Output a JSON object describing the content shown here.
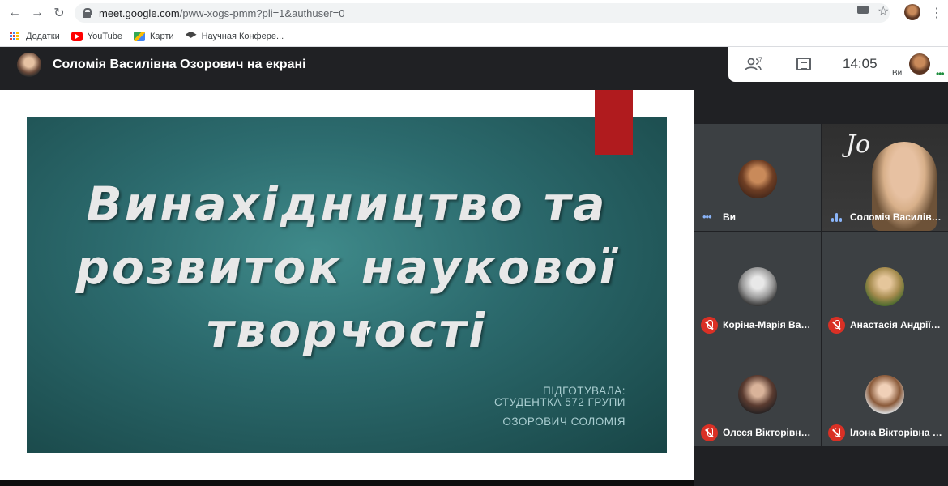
{
  "browser": {
    "url_host": "meet.google.com",
    "url_path": "/pww-xogs-pmm?pli=1&authuser=0",
    "bookmarks": [
      {
        "label": "Додатки",
        "icon": "apps-icon"
      },
      {
        "label": "YouTube",
        "icon": "youtube-icon"
      },
      {
        "label": "Карти",
        "icon": "maps-icon"
      },
      {
        "label": "Научная Конфере...",
        "icon": "graduation-cap-icon"
      }
    ]
  },
  "meet": {
    "presenting_title": "Соломія Василівна Озорович на екрані",
    "participants_count": "7",
    "time": "14:05",
    "self_label": "Ви"
  },
  "slide": {
    "title_lines": [
      "Винахідництво та",
      "розвиток наукової",
      "творчості"
    ],
    "subtitle_lines": [
      "ПІДГОТУВАЛА:",
      "СТУДЕНТКА 572 ГРУПИ",
      "ОЗОРОВИЧ СОЛОМІЯ"
    ]
  },
  "participants": [
    {
      "name": "Ви",
      "status": "speaking-dots"
    },
    {
      "name": "Соломія Василівн...",
      "status": "speaking"
    },
    {
      "name": "Коріна-Марія Васи...",
      "status": "muted"
    },
    {
      "name": "Анастасія Андріїв...",
      "status": "muted"
    },
    {
      "name": "Олеся Вікторівна ...",
      "status": "muted"
    },
    {
      "name": "Ілона Вікторівна К...",
      "status": "muted"
    }
  ]
}
